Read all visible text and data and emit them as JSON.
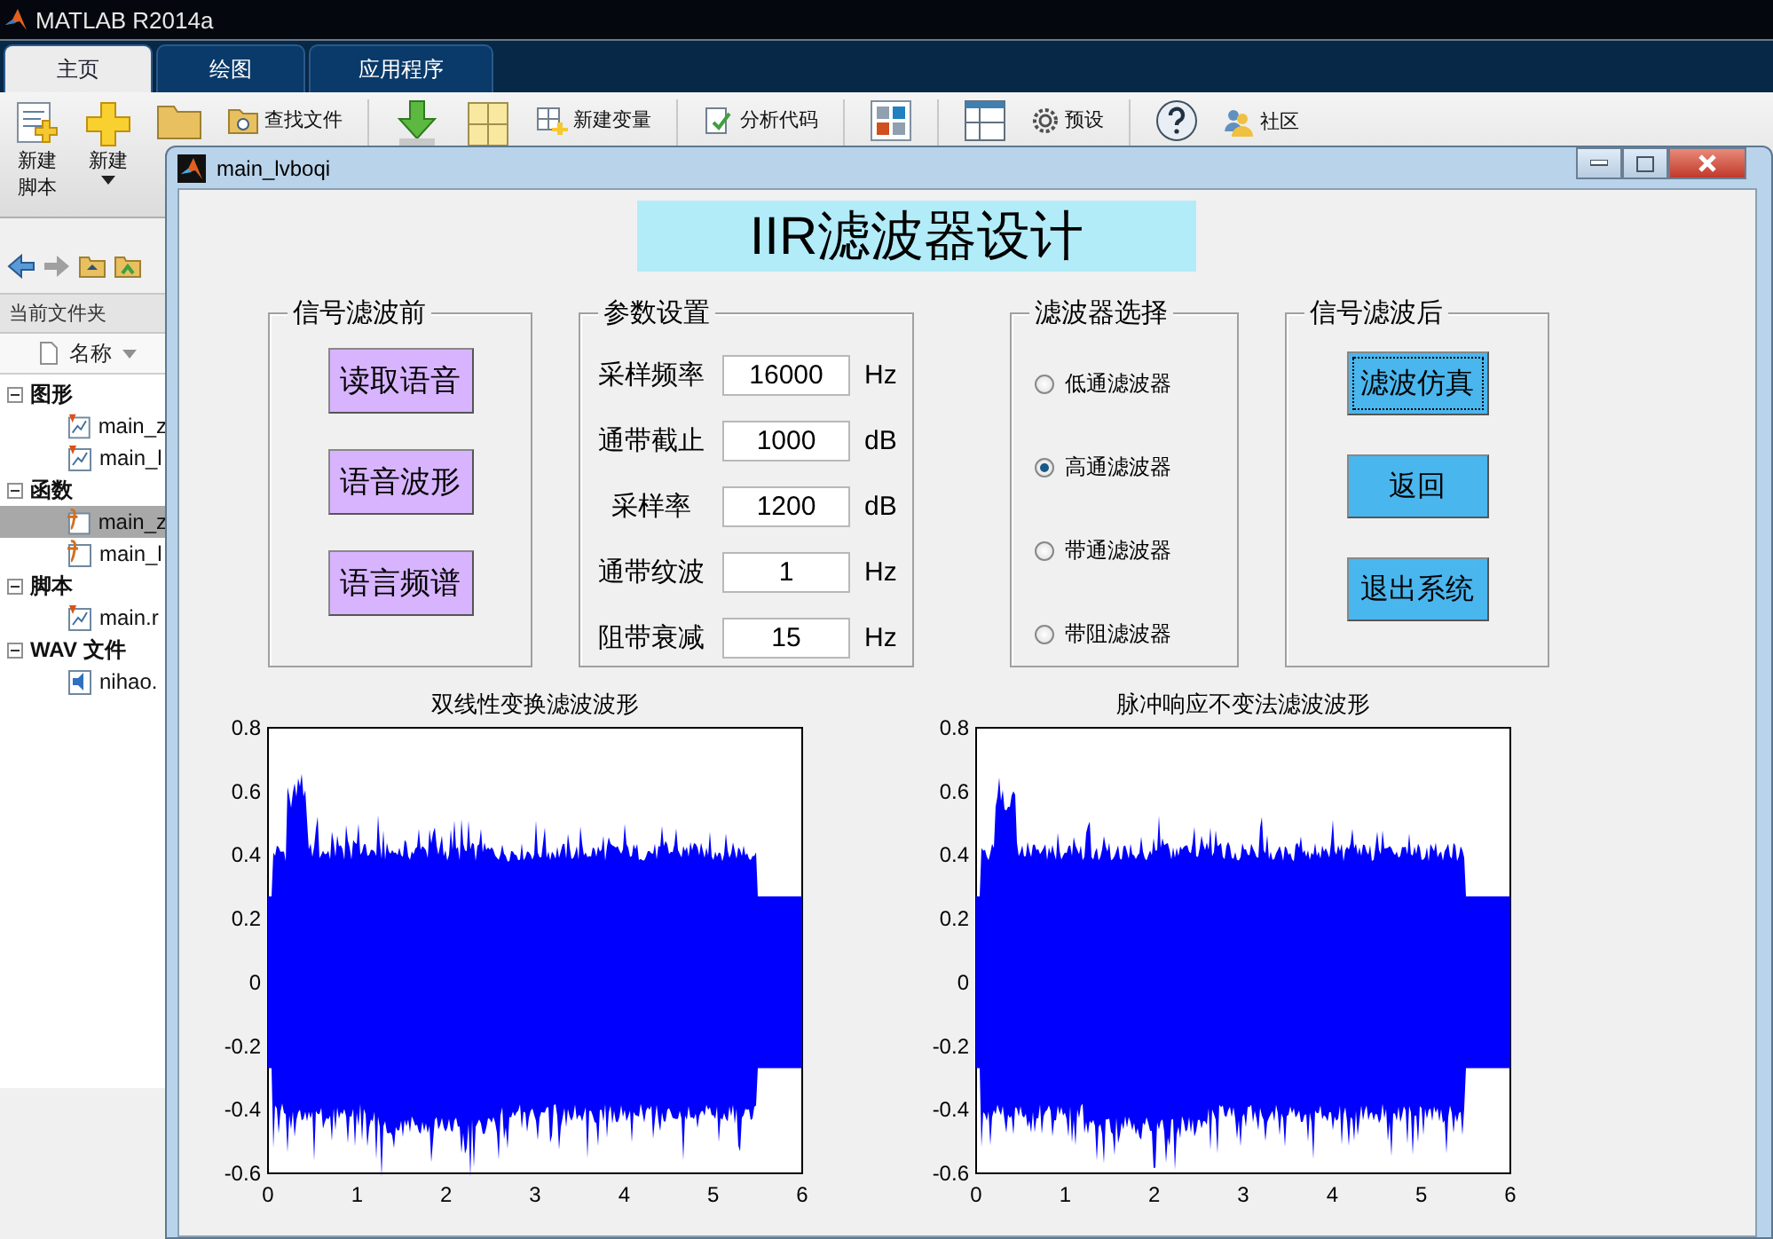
{
  "app": {
    "title": "MATLAB R2014a"
  },
  "ribbon_tabs": [
    {
      "label": "主页",
      "selected": true
    },
    {
      "label": "绘图",
      "selected": false
    },
    {
      "label": "应用程序",
      "selected": false
    }
  ],
  "toolstrip": [
    {
      "kind": "script",
      "lines": [
        "新建",
        "脚本"
      ]
    },
    {
      "kind": "new",
      "lines": [
        "新建"
      ]
    },
    {
      "kind": "folder"
    },
    {
      "kind": "find",
      "lines": [
        "查找文件"
      ]
    },
    {
      "kind": "import"
    },
    {
      "kind": "workspace"
    },
    {
      "kind": "variable",
      "lines": [
        "新建变量"
      ]
    },
    {
      "kind": "analyze",
      "lines": [
        "分析代码"
      ]
    },
    {
      "kind": "layout"
    },
    {
      "kind": "grid"
    },
    {
      "kind": "preferences",
      "lines": [
        "预设"
      ]
    },
    {
      "kind": "help"
    },
    {
      "kind": "community",
      "lines": [
        "社区"
      ]
    }
  ],
  "file_browser": {
    "title": "当前文件夹",
    "column": "名称",
    "groups": [
      {
        "label": "图形",
        "expanded": true,
        "children": [
          {
            "label": "main_z",
            "kind": "fig",
            "selected": false
          },
          {
            "label": "main_l",
            "kind": "fig",
            "selected": false
          }
        ]
      },
      {
        "label": "函数",
        "expanded": true,
        "children": [
          {
            "label": "main_z",
            "kind": "func",
            "selected": true
          },
          {
            "label": "main_l",
            "kind": "func",
            "selected": false
          }
        ]
      },
      {
        "label": "脚本",
        "expanded": true,
        "children": [
          {
            "label": "main.r",
            "kind": "fig",
            "selected": false
          }
        ]
      },
      {
        "label": "WAV 文件",
        "expanded": true,
        "children": [
          {
            "label": "nihao.",
            "kind": "wav",
            "selected": false
          }
        ]
      }
    ]
  },
  "figure": {
    "title": "main_lvboqi",
    "heading": "IIR滤波器设计",
    "before_panel": {
      "title": "信号滤波前",
      "buttons": [
        "读取语音",
        "语音波形",
        "语言频谱"
      ]
    },
    "params_panel": {
      "title": "参数设置",
      "rows": [
        {
          "label": "采样频率",
          "value": "16000",
          "unit": "Hz"
        },
        {
          "label": "通带截止",
          "value": "1000",
          "unit": "dB"
        },
        {
          "label": "采样率",
          "value": "1200",
          "unit": "dB"
        },
        {
          "label": "通带纹波",
          "value": "1",
          "unit": "Hz"
        },
        {
          "label": "阻带衰减",
          "value": "15",
          "unit": "Hz"
        }
      ]
    },
    "filter_panel": {
      "title": "滤波器选择",
      "options": [
        {
          "label": "低通滤波器",
          "selected": false
        },
        {
          "label": "高通滤波器",
          "selected": true
        },
        {
          "label": "带通滤波器",
          "selected": false
        },
        {
          "label": "带阻滤波器",
          "selected": false
        }
      ]
    },
    "after_panel": {
      "title": "信号滤波后",
      "buttons": [
        {
          "label": "滤波仿真",
          "focused": true
        },
        {
          "label": "返回",
          "focused": false
        },
        {
          "label": "退出系统",
          "focused": false
        }
      ]
    },
    "plots": [
      {
        "title": "双线性变换滤波波形",
        "yticks": [
          "0.8",
          "0.6",
          "0.4",
          "0.2",
          "0",
          "-0.2",
          "-0.4",
          "-0.6"
        ],
        "xticks": [
          "0",
          "1",
          "2",
          "3",
          "4",
          "5",
          "6"
        ]
      },
      {
        "title": "脉冲响应不变法滤波波形",
        "yticks": [
          "0.8",
          "0.6",
          "0.4",
          "0.2",
          "0",
          "-0.2",
          "-0.4",
          "-0.6"
        ],
        "xticks": [
          "0",
          "1",
          "2",
          "3",
          "4",
          "5",
          "6"
        ]
      }
    ]
  }
}
